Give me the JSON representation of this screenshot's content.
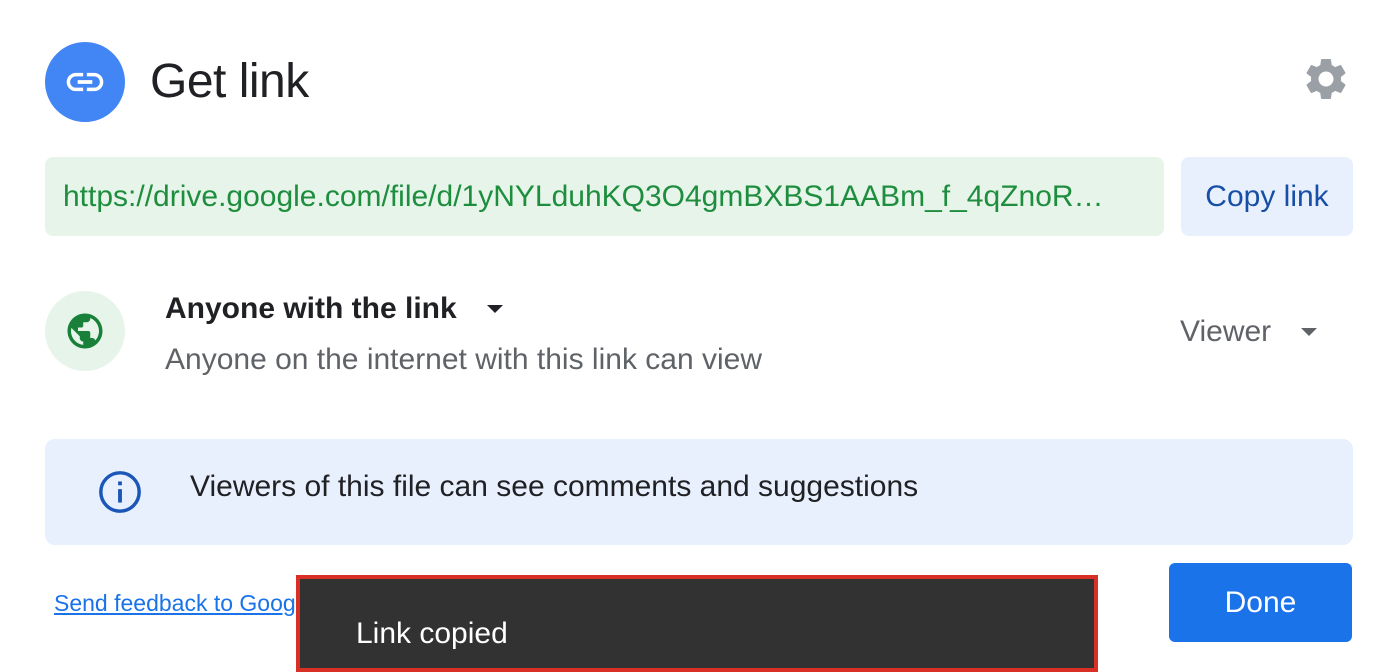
{
  "header": {
    "title": "Get link",
    "icon": "link-icon",
    "settings_icon": "gear-icon"
  },
  "link": {
    "url": "https://drive.google.com/file/d/1yNYLduhKQ3O4gmBXBS1AABm_f_4qZnoR…",
    "copy_label": "Copy link"
  },
  "access": {
    "icon": "globe-icon",
    "scope_label": "Anyone with the link",
    "description": "Anyone on the internet with this link can view",
    "role_label": "Viewer"
  },
  "info": {
    "icon": "info-icon",
    "text": "Viewers of this file can see comments and suggestions"
  },
  "footer": {
    "feedback_label": "Send feedback to Goog",
    "done_label": "Done"
  },
  "toast": {
    "text": "Link copied"
  },
  "colors": {
    "brand_blue": "#4285f4",
    "button_blue": "#1a73e8",
    "link_text_blue": "#1a73e8",
    "copy_text_blue": "#174ea6",
    "copy_bg": "#e8f0fe",
    "url_green": "#1e8e3e",
    "url_bg": "#e6f4ea",
    "globe_green": "#188038",
    "globe_bg": "#e6f4ea",
    "info_bg": "#e8f0fe",
    "info_icon": "#1a56b8",
    "gear_grey": "#9aa0a6",
    "toast_border": "#d93025"
  }
}
